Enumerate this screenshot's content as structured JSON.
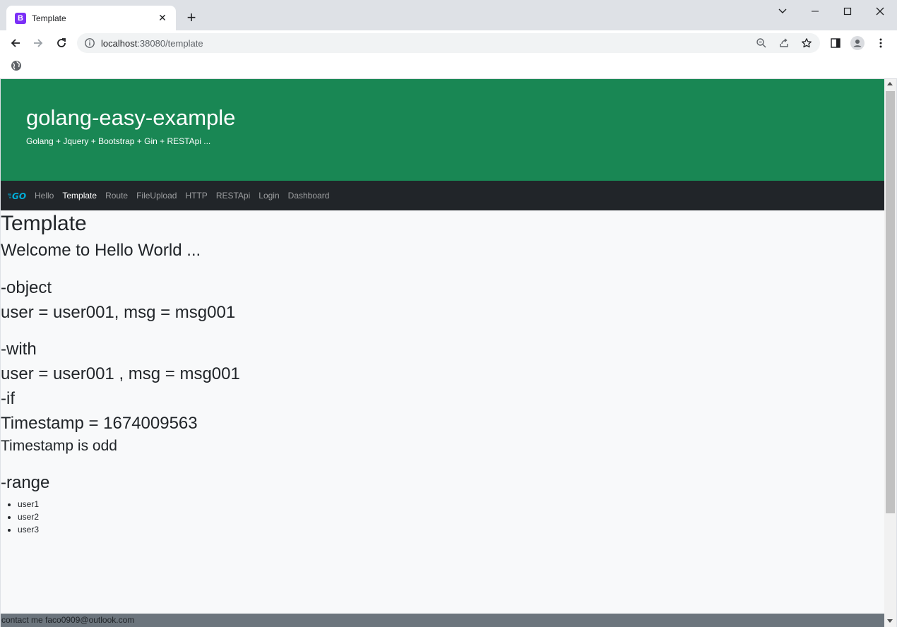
{
  "browser": {
    "tab": {
      "title": "Template",
      "favicon_letter": "B"
    },
    "url": {
      "host": "localhost",
      "path": ":38080/template"
    },
    "icons": [
      "back-icon",
      "forward-icon",
      "reload-icon",
      "info-icon",
      "zoom-out-icon",
      "share-icon",
      "star-icon",
      "side-panel-icon",
      "profile-icon",
      "menu-icon",
      "globe-icon"
    ]
  },
  "hero": {
    "title": "golang-easy-example",
    "subtitle": "Golang + Jquery + Bootstrap + Gin + RESTApi ..."
  },
  "navbar": {
    "brand": "GO",
    "items": [
      "Hello",
      "Template",
      "Route",
      "FileUpload",
      "HTTP",
      "RESTApi",
      "Login",
      "Dashboard"
    ],
    "active": "Template"
  },
  "content": {
    "heading": "Template",
    "welcome": "Welcome to Hello World ...",
    "object_heading": "-object",
    "object_line": "user = user001, msg = msg001",
    "with_heading": "-with",
    "with_line": "user = user001 , msg = msg001",
    "if_heading": "-if",
    "timestamp_line": "Timestamp = 1674009563",
    "odd_line": "Timestamp is odd",
    "range_heading": "-range",
    "range_items": [
      "user1",
      "user2",
      "user3"
    ]
  },
  "status": "contact me faco0909@outlook.com",
  "colors": {
    "hero": "#198754",
    "navbar": "#212529",
    "page_bg": "#f8f9fa",
    "status_bar": "#6c757d"
  }
}
